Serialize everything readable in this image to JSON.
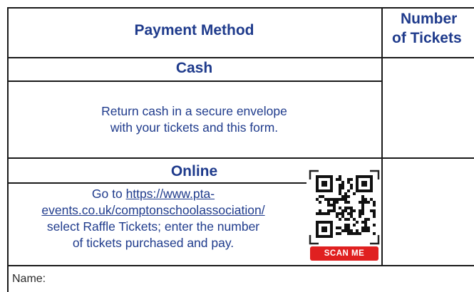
{
  "header": {
    "payment_method": "Payment Method",
    "tickets_line1": "Number",
    "tickets_line2": "of Tickets"
  },
  "cash": {
    "title": "Cash",
    "line1": "Return cash in a secure envelope",
    "line2": "with your tickets and this form."
  },
  "online": {
    "title": "Online",
    "line1_prefix": "Go to ",
    "link_part1": "https://www.pta-",
    "link_part2": "events.co.uk/comptonschoolassociation/",
    "line3": "select Raffle Tickets; enter the number",
    "line4": "of tickets purchased and pay.",
    "qr_badge": "SCAN ME"
  },
  "footer": {
    "name_label": "Name:"
  },
  "colors": {
    "text_blue": "#1f3b8c",
    "badge_red": "#e02020"
  }
}
